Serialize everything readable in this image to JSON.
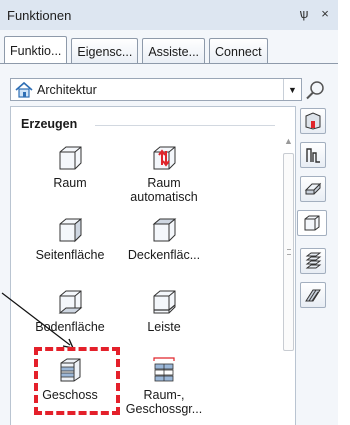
{
  "titlebar": {
    "title": "Funktionen",
    "pin_glyph": "ѱ",
    "close_glyph": "×"
  },
  "tabs": [
    {
      "label": "Funktio...",
      "active": true
    },
    {
      "label": "Eigensc...",
      "active": false
    },
    {
      "label": "Assiste...",
      "active": false
    },
    {
      "label": "Connect",
      "active": false
    }
  ],
  "module_select": {
    "value": "Architektur"
  },
  "group": {
    "title": "Erzeugen"
  },
  "items": [
    {
      "label": "Raum",
      "icon": "room-box-icon"
    },
    {
      "label": "Raum automatisch",
      "line1": "Raum",
      "line2": "automatisch",
      "icon": "room-automatic-icon"
    },
    {
      "label": "Seitenfläche",
      "icon": "side-surface-icon"
    },
    {
      "label": "Deckenfläc...",
      "icon": "ceiling-surface-icon"
    },
    {
      "label": "Bodenfläche",
      "icon": "floor-surface-icon"
    },
    {
      "label": "Leiste",
      "icon": "skirting-board-icon"
    },
    {
      "label": "Geschoss",
      "icon": "storey-icon"
    },
    {
      "label": "Raum-, Geschossgr...",
      "line1": "Raum-,",
      "line2": "Geschossgr...",
      "icon": "room-storey-group-icon"
    }
  ],
  "sidebar_icons": [
    "wall-door-icon",
    "column-profile-icon",
    "slab-icon",
    "room-icon",
    "storey-stack-icon",
    "roof-icon"
  ],
  "annotation": {
    "highlight_color": "#e4202a",
    "highlighted_item": "Geschoss"
  }
}
